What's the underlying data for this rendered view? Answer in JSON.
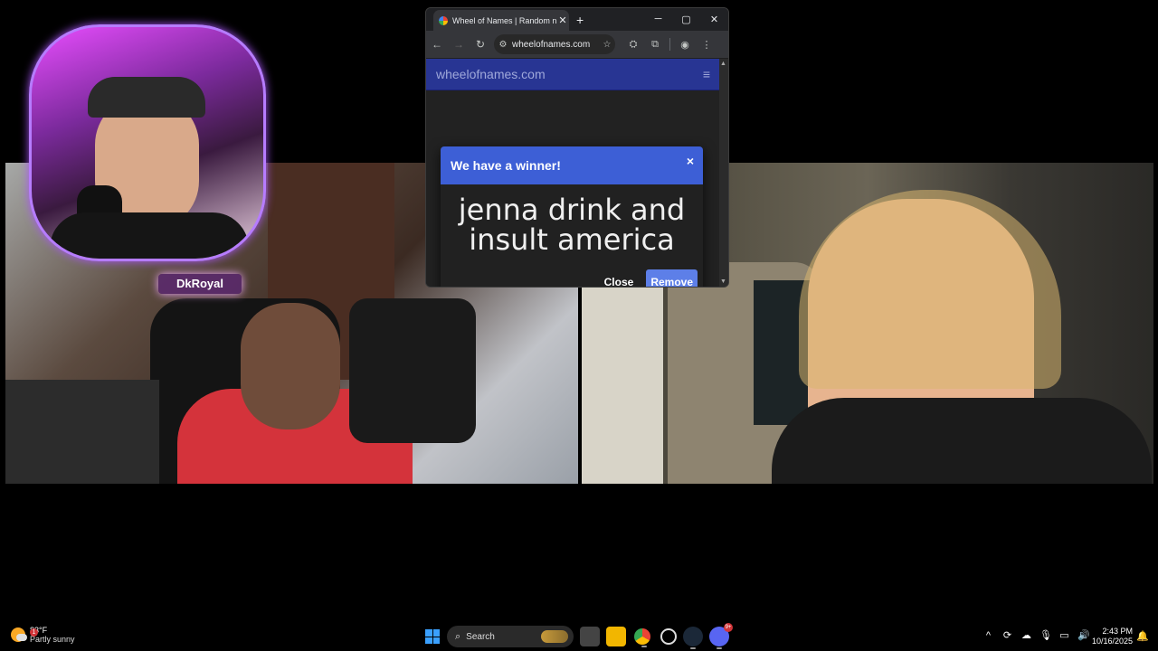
{
  "overlay": {
    "name_sign": "DkRoyal"
  },
  "browser": {
    "tab_title": "Wheel of Names | Random nam",
    "tab_close": "✕",
    "new_tab": "+",
    "window_buttons": {
      "minimize": "─",
      "maximize": "▢",
      "close": "✕"
    },
    "nav": {
      "back": "←",
      "forward": "→",
      "reload": "↻"
    },
    "url": "wheelofnames.com",
    "site": {
      "logo_text": "wheelofnames.com",
      "menu_icon": "≡"
    },
    "modal": {
      "title": "We have a winner!",
      "close_x": "×",
      "winner_text": "jenna drink and insult america",
      "close_label": "Close",
      "remove_label": "Remove"
    }
  },
  "taskbar": {
    "weather": {
      "badge": "1",
      "temp": "83°F",
      "condition": "Partly sunny"
    },
    "search_label": "Search",
    "tray": {
      "chevron": "^"
    },
    "clock": {
      "time": "2:43 PM",
      "date": "10/16/2025"
    },
    "discord_badge": "9+"
  },
  "colors": {
    "modal_header": "#3d5fd6",
    "remove_button": "#5d7fe8",
    "site_header": "#283593",
    "overlay_border": "#b67cff"
  }
}
